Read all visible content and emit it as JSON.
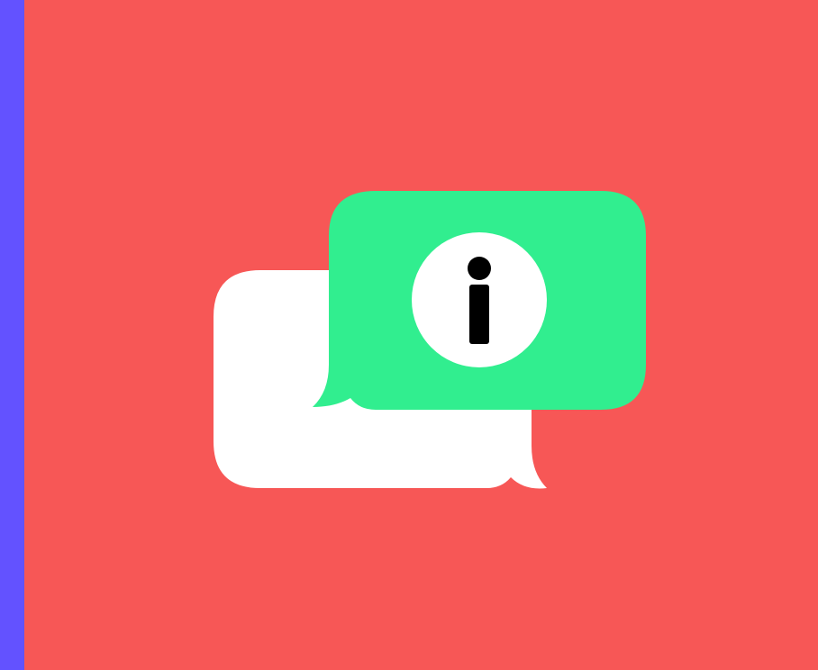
{
  "colors": {
    "background": "#f75756",
    "left_strip": "#6352ff",
    "back_bubble": "#ffffff",
    "front_bubble": "#31ee8f",
    "info_circle": "#ffffff",
    "info_glyph": "#000000"
  },
  "illustration": {
    "icon_front": "info-icon",
    "icon_back": "speech-bubble-icon"
  }
}
